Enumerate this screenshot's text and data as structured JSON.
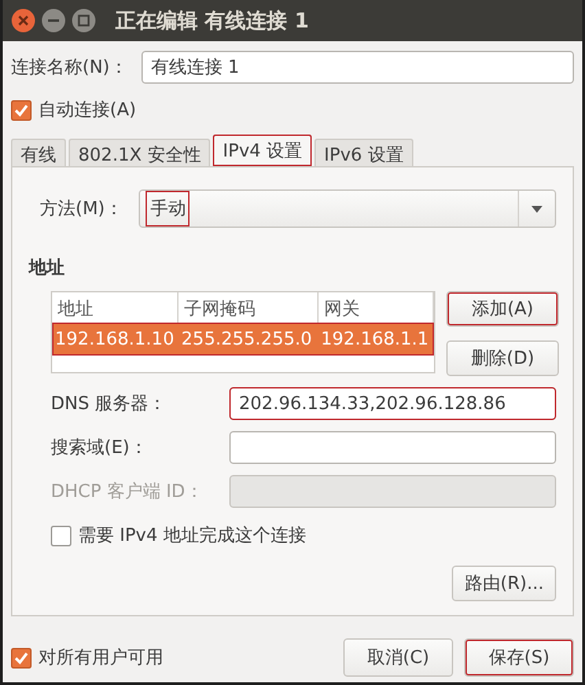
{
  "window": {
    "title": "正在编辑 有线连接 1"
  },
  "connection_name": {
    "label": "连接名称(N)：",
    "value": "有线连接 1"
  },
  "auto_connect": {
    "label": "自动连接(A)",
    "checked": true
  },
  "tabs": [
    {
      "label": "有线",
      "selected": false,
      "highlighted": false
    },
    {
      "label": "802.1X 安全性",
      "selected": false,
      "highlighted": false
    },
    {
      "label": "IPv4 设置",
      "selected": true,
      "highlighted": true
    },
    {
      "label": "IPv6 设置",
      "selected": false,
      "highlighted": false
    }
  ],
  "method": {
    "label": "方法(M)：",
    "value": "手动",
    "highlighted": true
  },
  "addresses": {
    "heading": "地址",
    "columns": [
      "地址",
      "子网掩码",
      "网关"
    ],
    "rows": [
      {
        "cells": [
          "192.168.1.10",
          "255.255.255.0",
          "192.168.1.1"
        ],
        "selected": true,
        "highlighted": true
      }
    ],
    "buttons": [
      {
        "label": "添加(A)",
        "highlighted": true
      },
      {
        "label": "删除(D)",
        "highlighted": false
      }
    ]
  },
  "fields": [
    {
      "label": "DNS 服务器：",
      "value": "202.96.134.33,202.96.128.86",
      "disabled": false,
      "highlighted": true
    },
    {
      "label": "搜索域(E)：",
      "disabled": false,
      "highlighted": false
    },
    {
      "label": "DHCP 客户端 ID：",
      "disabled": true,
      "highlighted": false
    }
  ],
  "require_ipv4": {
    "label": "需要 IPv4 地址完成这个连接",
    "checked": false
  },
  "routes_button": {
    "label": "路由(R)..."
  },
  "all_users": {
    "label": "对所有用户可用",
    "checked": true
  },
  "footer_buttons": [
    {
      "label": "取消(C)",
      "highlighted": false
    },
    {
      "label": "保存(S)",
      "highlighted": true
    }
  ]
}
